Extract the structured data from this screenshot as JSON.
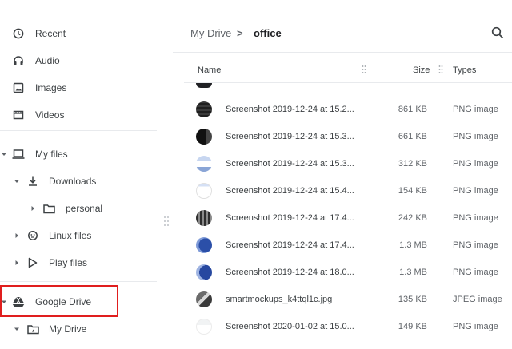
{
  "sidebar": {
    "recent": "Recent",
    "audio": "Audio",
    "images": "Images",
    "videos": "Videos",
    "my_files": "My files",
    "downloads": "Downloads",
    "personal": "personal",
    "linux_files": "Linux files",
    "play_files": "Play files",
    "google_drive": "Google Drive",
    "my_drive": "My Drive"
  },
  "header": {
    "breadcrumb_root": "My Drive",
    "breadcrumb_sep": ">",
    "breadcrumb_current": "office"
  },
  "columns": {
    "name": "Name",
    "size": "Size",
    "types": "Types"
  },
  "files": [
    {
      "name": "Screenshot 2019-12-24 at 15.2...",
      "size": "861 KB",
      "type": "PNG image"
    },
    {
      "name": "Screenshot 2019-12-24 at 15.3...",
      "size": "661 KB",
      "type": "PNG image"
    },
    {
      "name": "Screenshot 2019-12-24 at 15.3...",
      "size": "312 KB",
      "type": "PNG image"
    },
    {
      "name": "Screenshot 2019-12-24 at 15.4...",
      "size": "154 KB",
      "type": "PNG image"
    },
    {
      "name": "Screenshot 2019-12-24 at 17.4...",
      "size": "242 KB",
      "type": "PNG image"
    },
    {
      "name": "Screenshot 2019-12-24 at 17.4...",
      "size": "1.3 MB",
      "type": "PNG image"
    },
    {
      "name": "Screenshot 2019-12-24 at 18.0...",
      "size": "1.3 MB",
      "type": "PNG image"
    },
    {
      "name": "smartmockups_k4ttql1c.jpg",
      "size": "135 KB",
      "type": "JPEG image"
    },
    {
      "name": "Screenshot 2020-01-02 at 15.0...",
      "size": "149 KB",
      "type": "PNG image"
    }
  ],
  "colors": {
    "highlight_border": "#e01e1e",
    "text": "#3c4043",
    "icon": "#5f6368",
    "divider": "#e8eaed"
  }
}
